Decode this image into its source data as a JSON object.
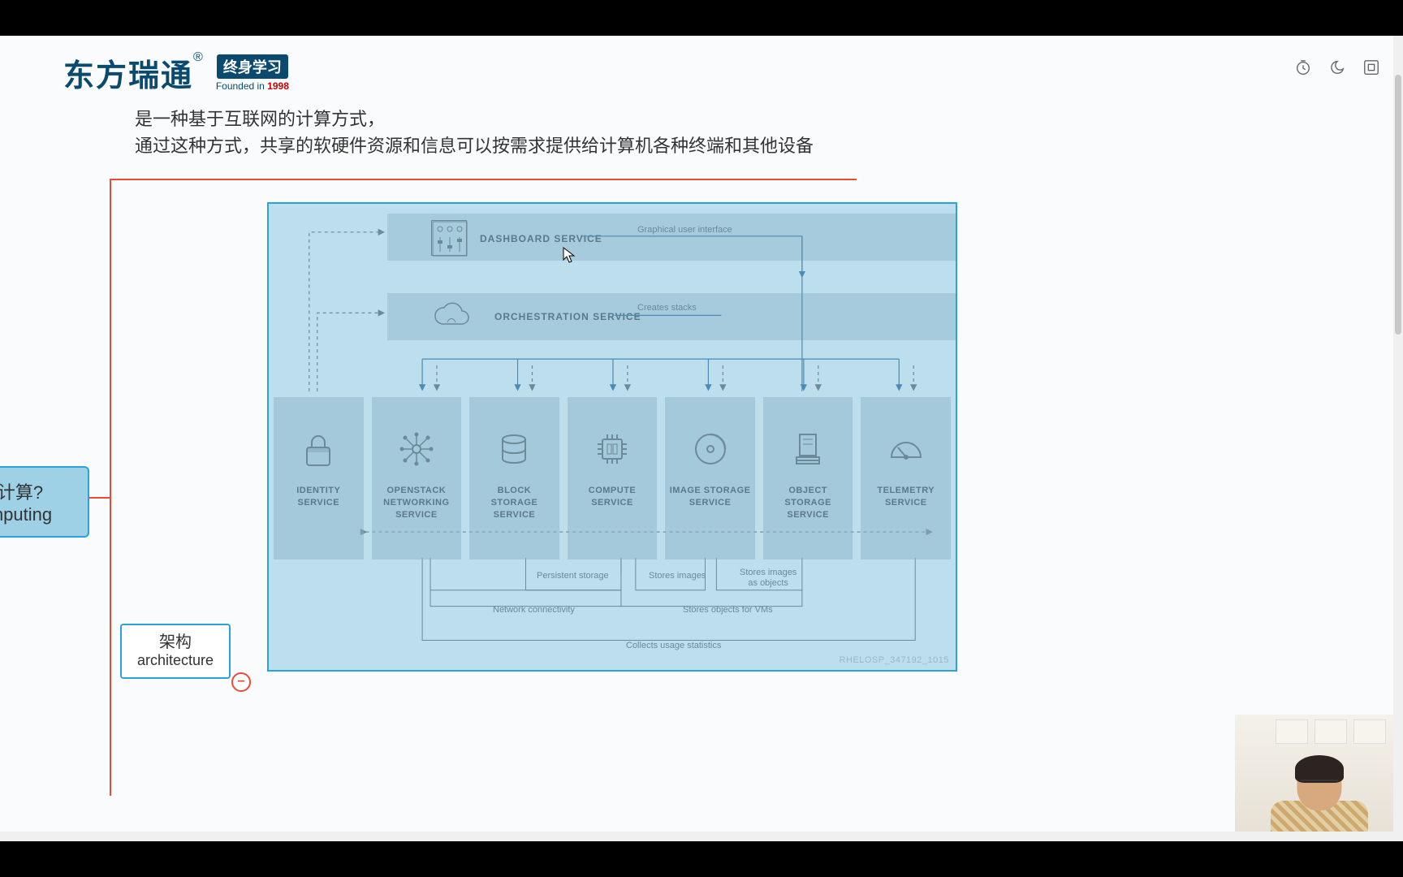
{
  "header": {
    "brand_cn": "东方瑞通",
    "brand_badge": "终身学习",
    "brand_founded_pre": "Founded in ",
    "brand_founded_year": "1998"
  },
  "intro": {
    "line1": "是一种基于互联网的计算方式，",
    "line2": "通过这种方式，共享的软硬件资源和信息可以按需求提供给计算机各种终端和其他设备"
  },
  "side": {
    "cloud_q": "计算?",
    "cloud_en": "mputing",
    "arch_cn": "架构",
    "arch_en": "architecture"
  },
  "diagram": {
    "dashboard": {
      "label": "DASHBOARD SERVICE",
      "sub": "Graphical user interface"
    },
    "orchestration": {
      "label": "ORCHESTRATION SERVICE",
      "sub": "Creates stacks"
    },
    "tiles": [
      {
        "name": "IDENTITY SERVICE"
      },
      {
        "name": "OPENSTACK NETWORKING SERVICE"
      },
      {
        "name": "BLOCK STORAGE SERVICE"
      },
      {
        "name": "COMPUTE SERVICE"
      },
      {
        "name": "IMAGE STORAGE SERVICE"
      },
      {
        "name": "OBJECT STORAGE SERVICE"
      },
      {
        "name": "TELEMETRY SERVICE"
      }
    ],
    "captions": {
      "persistent": "Persistent storage",
      "stores_images": "Stores images",
      "stores_images_obj1": "Stores images",
      "stores_images_obj2": "as objects",
      "net_conn": "Network connectivity",
      "stores_vms": "Stores objects for VMs",
      "collects": "Collects usage statistics"
    },
    "watermark": "RHELOSP_347192_1015"
  }
}
